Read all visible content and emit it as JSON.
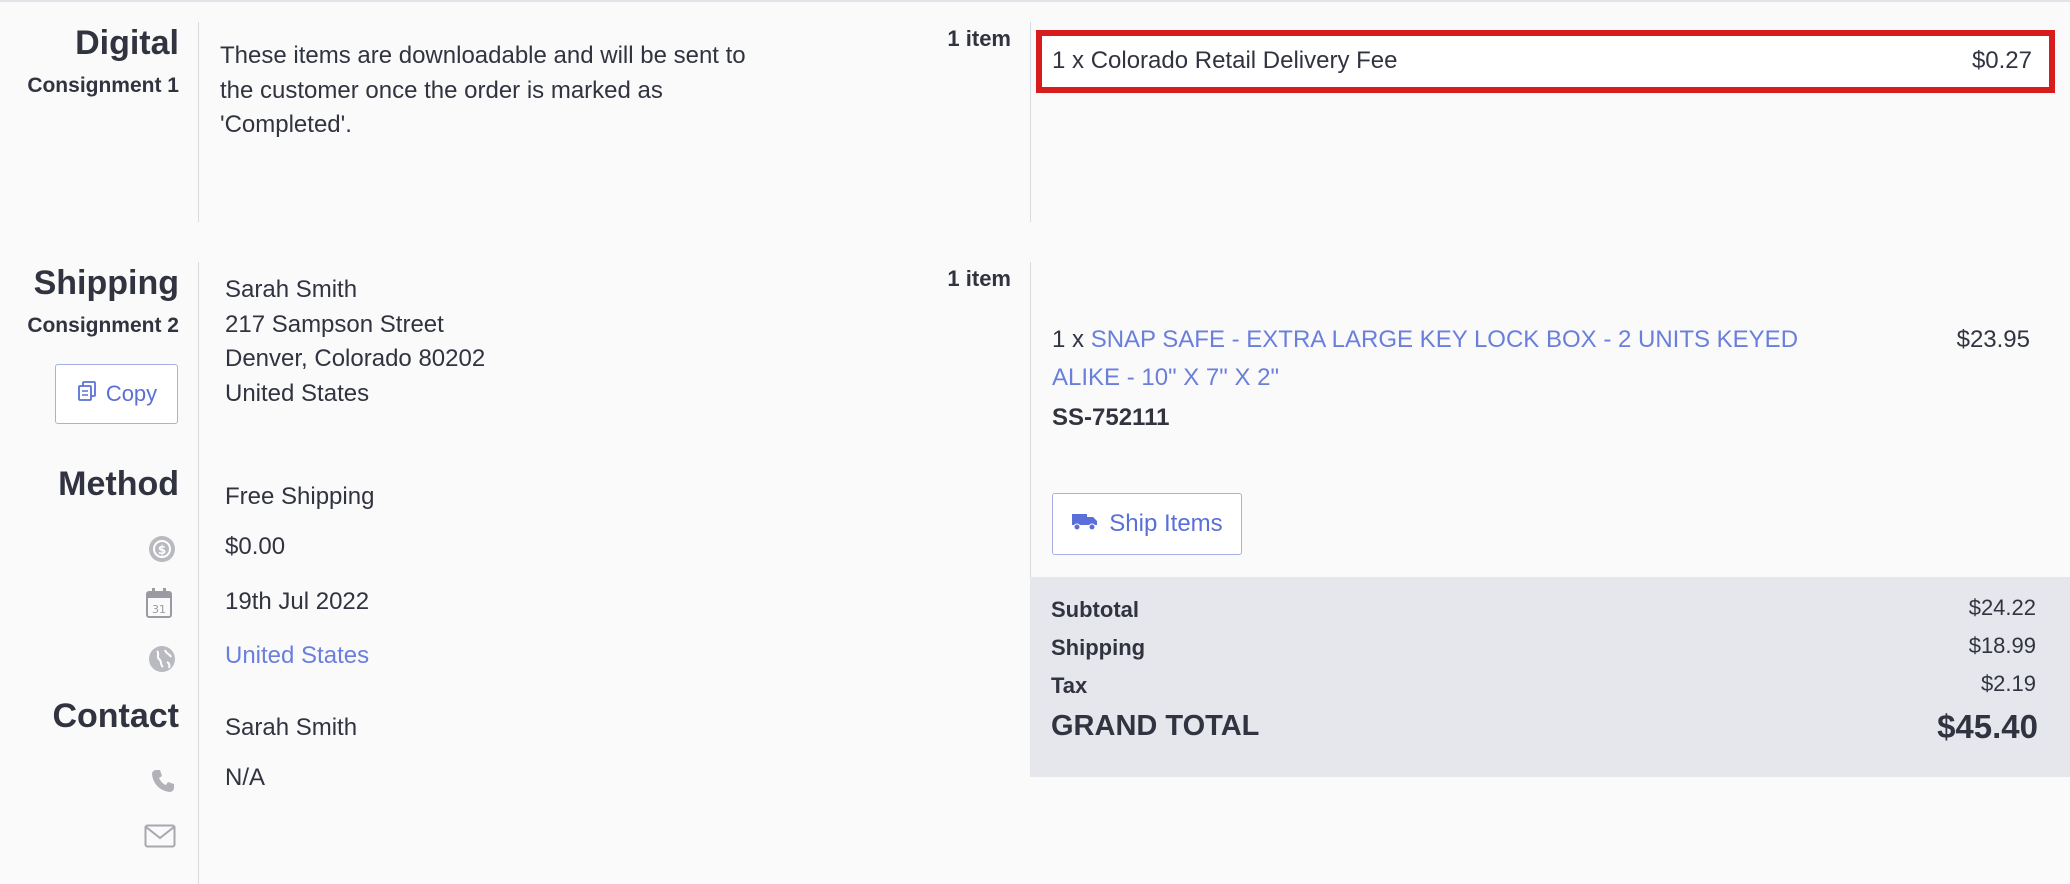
{
  "digital": {
    "title": "Digital",
    "subtitle": "Consignment 1",
    "description_lines": [
      "These items are downloadable and will be sent to",
      "the customer once the order is marked as",
      "'Completed'."
    ],
    "item_count": "1 item",
    "item": {
      "qty": "1 x",
      "name": "Colorado Retail Delivery Fee",
      "price": "$0.27"
    }
  },
  "shipping": {
    "title": "Shipping",
    "subtitle": "Consignment 2",
    "copy_label": "Copy",
    "address": {
      "name": "Sarah Smith",
      "street": "217 Sampson Street",
      "city_line": "Denver, Colorado 80202",
      "country": "United States"
    },
    "item_count": "1 item",
    "item": {
      "qty": "1 x",
      "name_line1": "SNAP SAFE - EXTRA LARGE KEY LOCK BOX - 2 UNITS KEYED",
      "name_line2": "ALIKE - 10\" X 7\" X 2\"",
      "sku": "SS-752111",
      "price": "$23.95"
    },
    "ship_items_label": "Ship Items"
  },
  "method": {
    "title": "Method",
    "name": "Free Shipping",
    "cost": "$0.00",
    "date": "19th Jul 2022",
    "country": "United States",
    "calendar_day": "31"
  },
  "contact": {
    "title": "Contact",
    "name": "Sarah Smith",
    "phone": "N/A"
  },
  "totals": {
    "subtotal_label": "Subtotal",
    "subtotal": "$24.22",
    "shipping_label": "Shipping",
    "shipping": "$18.99",
    "tax_label": "Tax",
    "tax": "$2.19",
    "grand_total_label": "GRAND TOTAL",
    "grand_total": "$45.40"
  },
  "colors": {
    "accent": "#6a7fdc",
    "highlight_border": "#d61c1c",
    "totals_bg": "#e6e7ec"
  }
}
